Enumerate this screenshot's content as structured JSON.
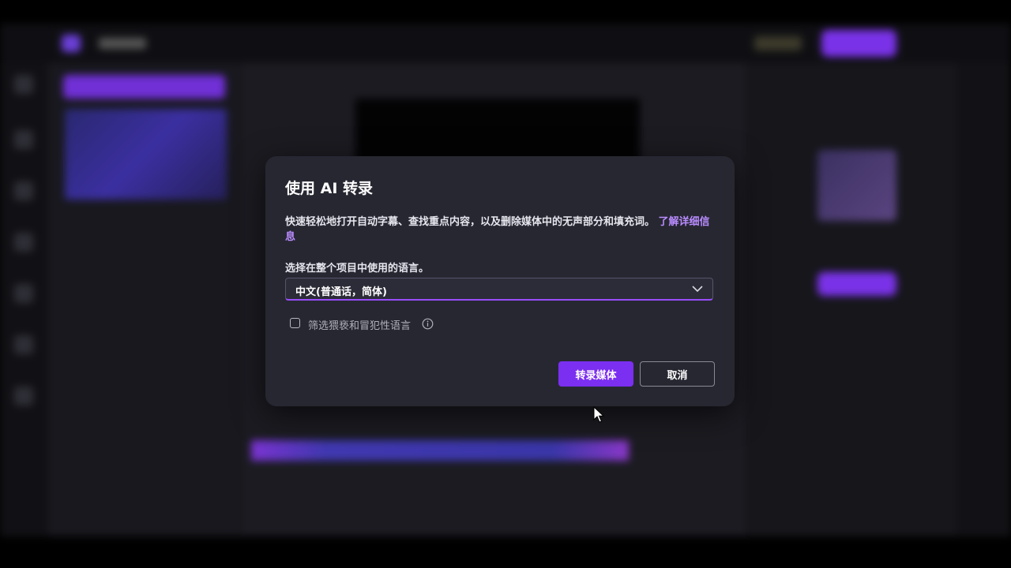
{
  "dialog": {
    "title": "使用 AI 转录",
    "description": "快速轻松地打开自动字幕、查找重点内容，以及删除媒体中的无声部分和填充词。",
    "learn_more": "了解详细信息",
    "language_label": "选择在整个项目中使用的语言。",
    "language_selected": "中文(普通话，简体)",
    "filter_label": "筛选猥亵和冒犯性语言",
    "filter_checked": false,
    "primary_button": "转录媒体",
    "secondary_button": "取消"
  },
  "icons": {
    "dropdown": "chevron-down-icon",
    "info": "info-icon",
    "cursor": "mouse-pointer-icon"
  },
  "colors": {
    "accent": "#7b2ff0",
    "link": "#b98cff",
    "dialog_bg": "#272732"
  }
}
